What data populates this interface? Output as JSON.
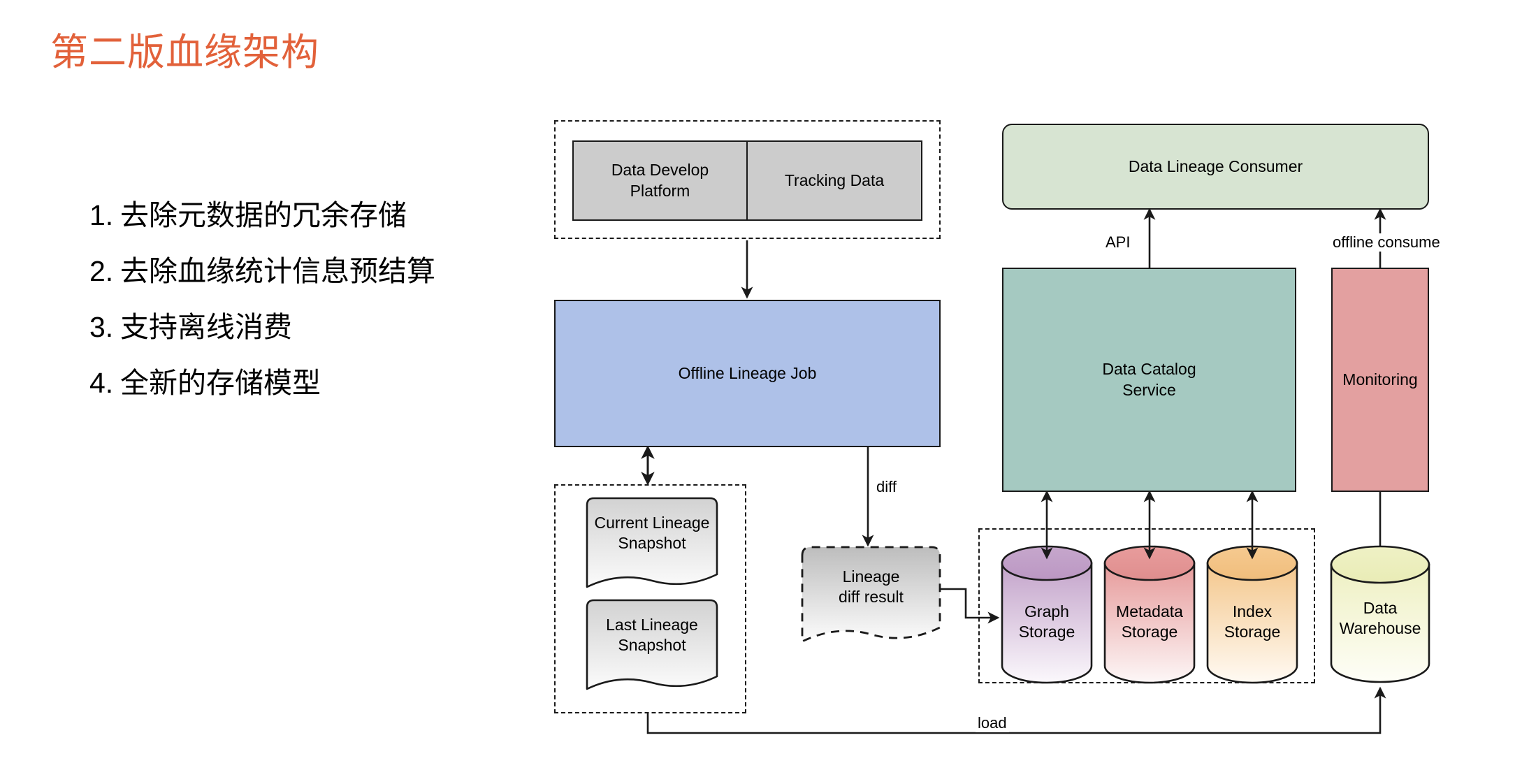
{
  "slide": {
    "title": "第二版血缘架构",
    "title_color": "#E2613A",
    "background": "#ffffff"
  },
  "bullets": [
    {
      "num": "1.",
      "text": "去除元数据的冗余存储"
    },
    {
      "num": "2.",
      "text": "去除血缘统计信息预结算"
    },
    {
      "num": "3.",
      "text": "支持离线消费"
    },
    {
      "num": "4.",
      "text": "全新的存储模型"
    }
  ],
  "diagram": {
    "nodes": {
      "data_develop_platform": {
        "label": "Data Develop\nPlatform",
        "color": "#cccccc",
        "shape": "rect"
      },
      "tracking_data": {
        "label": "Tracking Data",
        "color": "#cccccc",
        "shape": "rect"
      },
      "offline_lineage_job": {
        "label": "Offline Lineage Job",
        "color": "#aec1e8",
        "shape": "rect"
      },
      "current_lineage_snapshot": {
        "label": "Current Lineage\nSnapshot",
        "color": "#e0e0e0",
        "shape": "document"
      },
      "last_lineage_snapshot": {
        "label": "Last Lineage\nSnapshot",
        "color": "#e0e0e0",
        "shape": "document"
      },
      "lineage_diff_result": {
        "label": "Lineage\ndiff result",
        "color": "#d4d4d4",
        "shape": "document-dashed"
      },
      "data_lineage_consumer": {
        "label": "Data Lineage Consumer",
        "color": "#d7e4d2",
        "shape": "rounded-rect"
      },
      "data_catalog_service": {
        "label": "Data Catalog\nService",
        "color": "#a5c9c1",
        "shape": "rect"
      },
      "monitoring": {
        "label": "Monitoring",
        "color": "#e3a0a0",
        "shape": "rect"
      },
      "graph_storage": {
        "label": "Graph\nStorage",
        "color": "#c8a8cc",
        "shape": "cylinder"
      },
      "metadata_storage": {
        "label": "Metadata\nStorage",
        "color": "#e8a0a0",
        "shape": "cylinder"
      },
      "index_storage": {
        "label": "Index\nStorage",
        "color": "#f3c88e",
        "shape": "cylinder"
      },
      "data_warehouse": {
        "label": "Data\nWarehouse",
        "color": "#eff0c4",
        "shape": "cylinder"
      }
    },
    "edge_labels": {
      "api": "API",
      "offline_consume": "offline consume",
      "diff": "diff",
      "load": "load"
    }
  }
}
